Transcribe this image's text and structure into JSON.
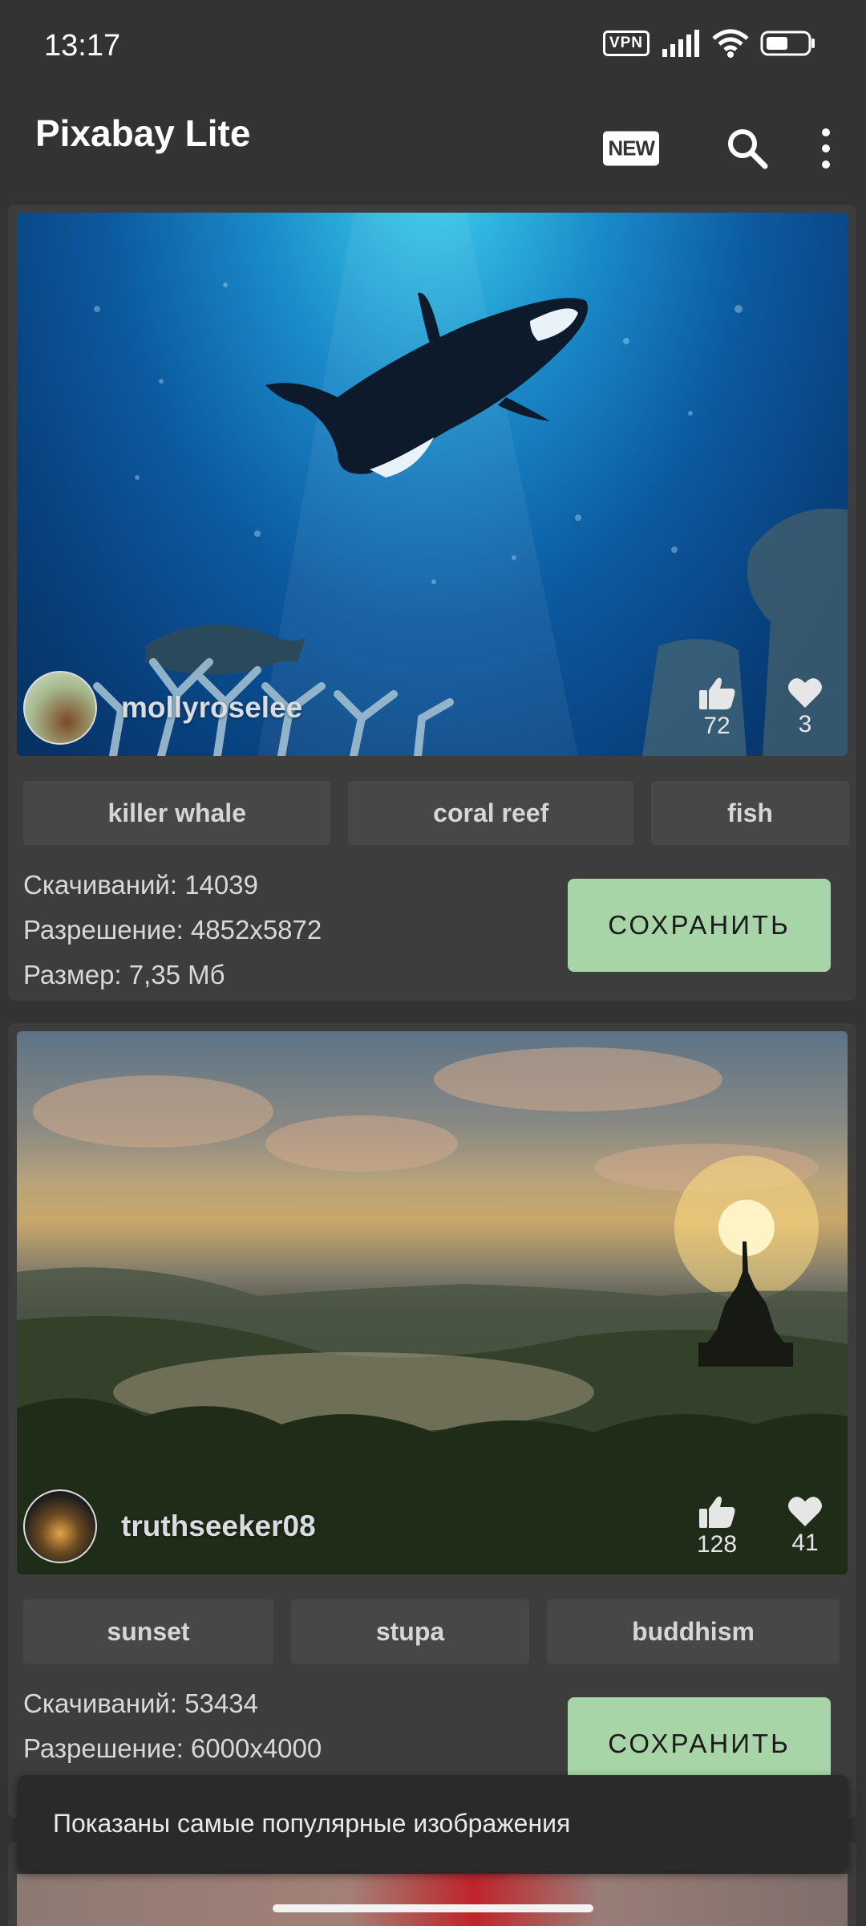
{
  "status_bar": {
    "time": "13:17",
    "vpn_label": "VPN",
    "icons": [
      "vpn-icon",
      "signal-icon",
      "wifi-icon",
      "battery-icon"
    ]
  },
  "app_bar": {
    "title": "Pixabay Lite",
    "new_label": "NEW",
    "actions": [
      "new-icon",
      "search-icon",
      "more-vert-icon"
    ]
  },
  "cards": [
    {
      "author": "mollyroselee",
      "likes": "72",
      "favorites": "3",
      "tags": [
        "killer whale",
        "coral reef",
        "fish"
      ],
      "downloads": "Скачиваний: 14039",
      "resolution": "Разрешение: 4852x5872",
      "size": "Размер: 7,35 Мб",
      "save_label": "СОХРАНИТЬ"
    },
    {
      "author": "truthseeker08",
      "likes": "128",
      "favorites": "41",
      "tags": [
        "sunset",
        "stupa",
        "buddhism"
      ],
      "downloads": "Скачиваний: 53434",
      "resolution": "Разрешение: 6000x4000",
      "save_label": "СОХРАНИТЬ"
    }
  ],
  "snackbar": {
    "message": "Показаны самые популярные изображения"
  },
  "colors": {
    "background": "#333333",
    "card": "#3d3d3d",
    "tag": "#474747",
    "save_button": "#a8d5a8",
    "snackbar": "#2a2a2a"
  }
}
